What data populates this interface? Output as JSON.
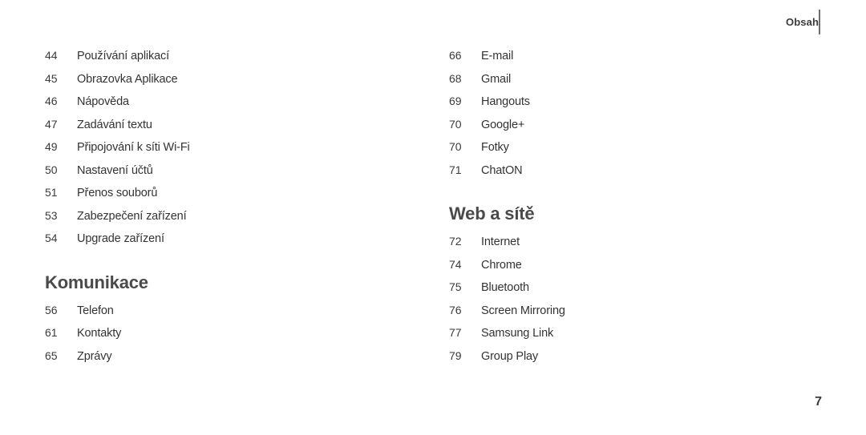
{
  "header": {
    "title": "Obsah"
  },
  "columns": [
    {
      "name": "left-column",
      "blocks": [
        {
          "type": "entries",
          "entries": [
            {
              "page": "44",
              "label": "Používání aplikací"
            },
            {
              "page": "45",
              "label": "Obrazovka Aplikace"
            },
            {
              "page": "46",
              "label": "Nápověda"
            },
            {
              "page": "47",
              "label": "Zadávání textu"
            },
            {
              "page": "49",
              "label": "Připojování k síti Wi-Fi"
            },
            {
              "page": "50",
              "label": "Nastavení účtů"
            },
            {
              "page": "51",
              "label": "Přenos souborů"
            },
            {
              "page": "53",
              "label": "Zabezpečení zařízení"
            },
            {
              "page": "54",
              "label": "Upgrade zařízení"
            }
          ]
        },
        {
          "type": "heading",
          "heading": "Komunikace"
        },
        {
          "type": "entries",
          "entries": [
            {
              "page": "56",
              "label": "Telefon"
            },
            {
              "page": "61",
              "label": "Kontakty"
            },
            {
              "page": "65",
              "label": "Zprávy"
            }
          ]
        }
      ]
    },
    {
      "name": "right-column",
      "blocks": [
        {
          "type": "entries",
          "entries": [
            {
              "page": "66",
              "label": "E-mail"
            },
            {
              "page": "68",
              "label": "Gmail"
            },
            {
              "page": "69",
              "label": "Hangouts"
            },
            {
              "page": "70",
              "label": "Google+"
            },
            {
              "page": "70",
              "label": "Fotky"
            },
            {
              "page": "71",
              "label": "ChatON"
            }
          ]
        },
        {
          "type": "heading",
          "heading": "Web a sítě"
        },
        {
          "type": "entries",
          "entries": [
            {
              "page": "72",
              "label": "Internet"
            },
            {
              "page": "74",
              "label": "Chrome"
            },
            {
              "page": "75",
              "label": "Bluetooth"
            },
            {
              "page": "76",
              "label": "Screen Mirroring"
            },
            {
              "page": "77",
              "label": "Samsung Link"
            },
            {
              "page": "79",
              "label": "Group Play"
            }
          ]
        }
      ]
    }
  ],
  "footer": {
    "page_number": "7"
  }
}
